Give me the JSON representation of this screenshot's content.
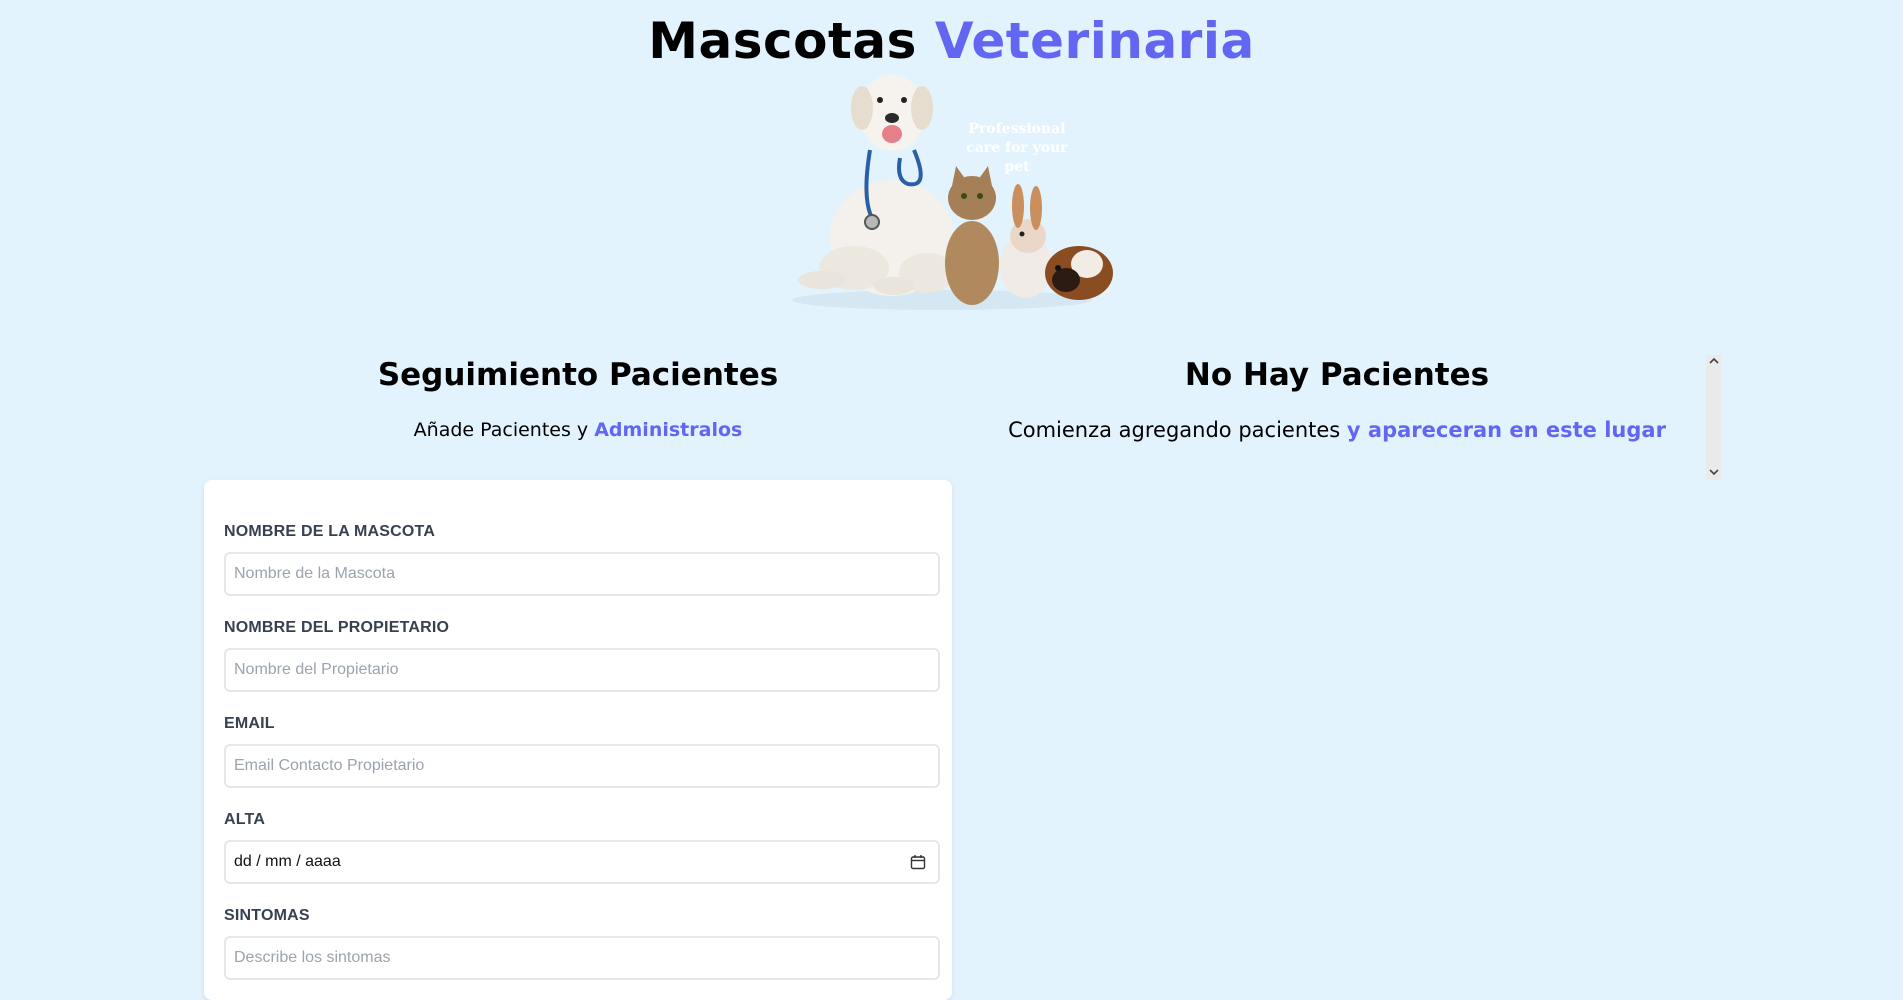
{
  "header": {
    "title_main": "Mascotas",
    "title_accent": "Veterinaria"
  },
  "hero": {
    "caption": "Professional care for your pet"
  },
  "form_section": {
    "heading": "Seguimiento Pacientes",
    "subtitle_text": "Añade Pacientes y ",
    "subtitle_accent": "Administralos"
  },
  "list_section": {
    "heading": "No Hay Pacientes",
    "subtitle_text": "Comienza agregando pacientes ",
    "subtitle_accent": "y apareceran en este lugar"
  },
  "form": {
    "pet_name": {
      "label": "Nombre de la Mascota",
      "placeholder": "Nombre de la Mascota"
    },
    "owner_name": {
      "label": "Nombre del Propietario",
      "placeholder": "Nombre del Propietario"
    },
    "email": {
      "label": "Email",
      "placeholder": "Email Contacto Propietario"
    },
    "discharge": {
      "label": "Alta",
      "value": "dd / mm / aaaa"
    },
    "symptoms": {
      "label": "Sintomas",
      "placeholder": "Describe los sintomas"
    }
  },
  "colors": {
    "background": "#e3f3fd",
    "accent": "#6366f1",
    "label": "#374151"
  },
  "icons": {
    "scroll_up": "chevron-up-icon",
    "scroll_down": "chevron-down-icon",
    "calendar": "calendar-icon"
  }
}
